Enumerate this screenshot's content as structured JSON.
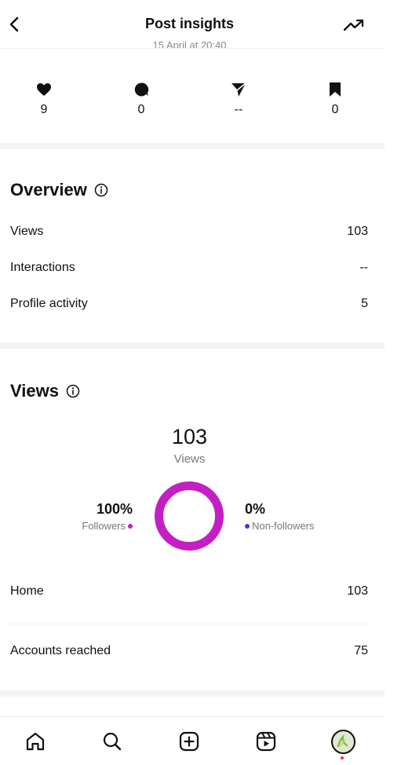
{
  "header": {
    "title": "Post insights",
    "date_partial": "15 April at 20:40"
  },
  "stats": [
    {
      "icon": "heart-icon",
      "value": "9"
    },
    {
      "icon": "comment-icon",
      "value": "0"
    },
    {
      "icon": "share-icon",
      "value": "--"
    },
    {
      "icon": "bookmark-icon",
      "value": "0"
    }
  ],
  "overview": {
    "title": "Overview",
    "rows": [
      {
        "label": "Views",
        "value": "103"
      },
      {
        "label": "Interactions",
        "value": "--"
      },
      {
        "label": "Profile activity",
        "value": "5"
      }
    ]
  },
  "views": {
    "title": "Views",
    "total": "103",
    "total_label": "Views",
    "followers_pct": "100%",
    "followers_label": "Followers",
    "followers_fraction": 1.0,
    "nonfollowers_pct": "0%",
    "nonfollowers_label": "Non-followers",
    "rows": [
      {
        "label": "Home",
        "value": "103"
      },
      {
        "label": "Accounts reached",
        "value": "75"
      }
    ]
  },
  "colors": {
    "followers": "#c41fc4",
    "non_followers": "#5a2fd0",
    "notification": "#ff3040"
  },
  "nav": [
    "home-icon",
    "search-icon",
    "create-icon",
    "reels-icon",
    "profile-avatar"
  ]
}
